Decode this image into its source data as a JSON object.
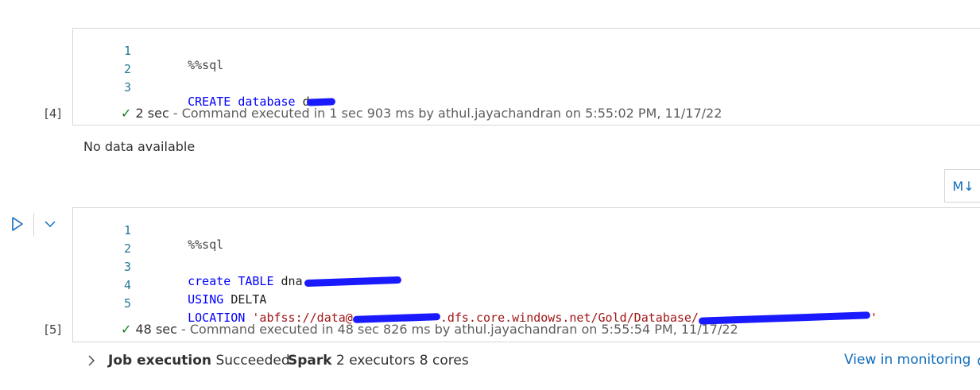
{
  "cell4": {
    "exec_count": "[4]",
    "lines": [
      {
        "n": "1",
        "magic": "%%sql"
      },
      {
        "n": "2"
      },
      {
        "n": "3",
        "kw": "CREATE database",
        "plain": "d"
      }
    ],
    "status_check": "✓",
    "status_duration": "2 sec",
    "status_text": "- Command executed in 1 sec 903 ms by athul.jayachandran on 5:55:02 PM, 11/17/22",
    "output": "No data available"
  },
  "markdown_button": "M↓",
  "cell5": {
    "exec_count": "[5]",
    "lines": [
      {
        "n": "1",
        "magic": "%%sql"
      },
      {
        "n": "2"
      },
      {
        "n": "3",
        "kw1": "create TABLE",
        "plain": "dna"
      },
      {
        "n": "4",
        "kw": "USING",
        "plain": "DELTA"
      },
      {
        "n": "5",
        "kw": "LOCATION",
        "str_a": "'abfss://data@",
        "str_b": ".dfs.core.windows.net/Gold/Database/",
        "str_end": "'"
      }
    ],
    "status_check": "✓",
    "status_duration": "48 sec",
    "status_text": "- Command executed in 48 sec 826 ms by athul.jayachandran on 5:55:54 PM, 11/17/22",
    "job_label": "Job execution",
    "job_value": "Succeeded",
    "spark_label": "Spark",
    "spark_value": "2 executors 8 cores",
    "monitor_link": "View in monitoring"
  },
  "icons": {
    "run": "run-triangle-icon",
    "collapse": "chevron-down-icon",
    "expand": "chevron-right-icon"
  },
  "colors": {
    "keyword": "#0000ff",
    "string": "#a31515",
    "line_number": "#237893",
    "success": "#107c10",
    "link": "#0f6cbd",
    "redaction": "#1a1aff"
  }
}
